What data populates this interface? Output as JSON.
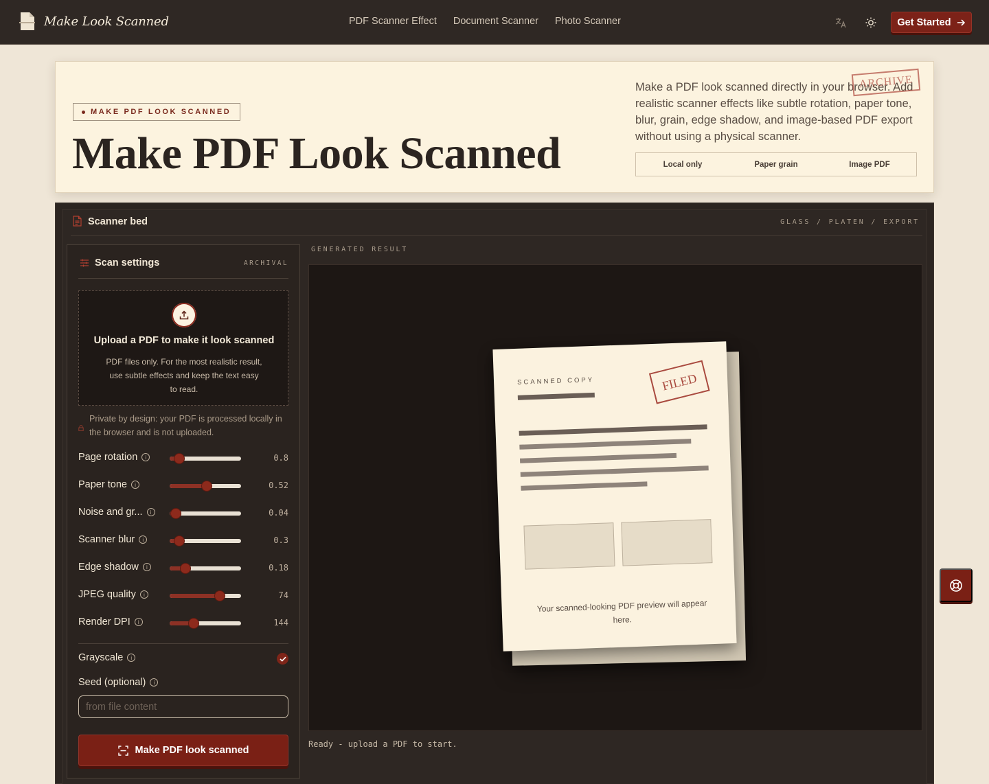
{
  "nav": {
    "brand": "Make Look Scanned",
    "links": [
      "PDF Scanner Effect",
      "Document Scanner",
      "Photo Scanner"
    ],
    "icons": [
      "translate-icon",
      "sun-icon"
    ],
    "cta": "Get Started"
  },
  "hero": {
    "eyebrow": "MAKE PDF LOOK SCANNED",
    "title": "Make PDF Look Scanned",
    "description": "Make a PDF look scanned directly in your browser. Add realistic scanner effects like subtle rotation, paper tone, blur, grain, edge shadow, and image-based PDF export without using a physical scanner.",
    "stamp": "ARCHIVE",
    "chips": [
      "Local only",
      "Paper grain",
      "Image PDF"
    ]
  },
  "bed": {
    "title": "Scanner bed",
    "meta": "GLASS / PLATEN / EXPORT"
  },
  "settings": {
    "title": "Scan settings",
    "tag": "ARCHIVAL",
    "upload_title": "Upload a PDF to make it look scanned",
    "upload_desc": "PDF files only. For the most realistic result, use subtle effects and keep the text easy to read.",
    "privacy": "Private by design: your PDF is processed locally in the browser and is not uploaded.",
    "sliders": [
      {
        "label": "Page rotation",
        "value": "0.8",
        "fraction": 0.13
      },
      {
        "label": "Paper tone",
        "value": "0.52",
        "fraction": 0.52
      },
      {
        "label": "Noise and gr...",
        "value": "0.04",
        "fraction": 0.09
      },
      {
        "label": "Scanner blur",
        "value": "0.3",
        "fraction": 0.13
      },
      {
        "label": "Edge shadow",
        "value": "0.18",
        "fraction": 0.22
      },
      {
        "label": "JPEG quality",
        "value": "74",
        "fraction": 0.7
      },
      {
        "label": "Render DPI",
        "value": "144",
        "fraction": 0.34
      }
    ],
    "grayscale_label": "Grayscale",
    "grayscale_checked": true,
    "seed_label": "Seed (optional)",
    "seed_placeholder": "from file content",
    "seed_value": "",
    "run_label": "Make PDF look scanned"
  },
  "result": {
    "label": "GENERATED RESULT",
    "paper_label": "SCANNED COPY",
    "paper_stamp": "FILED",
    "paper_caption": "Your scanned-looking PDF preview will appear here.",
    "status": "Ready - upload a PDF to start."
  },
  "colors": {
    "accent": "#7a2015",
    "nav_bg": "#2f2824",
    "hero_bg": "#fcf3df",
    "page_bg": "#efe6d7"
  }
}
